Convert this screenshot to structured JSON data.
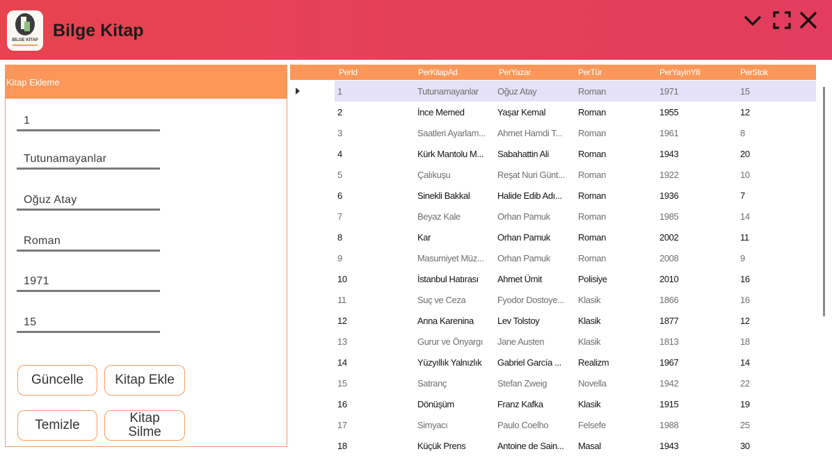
{
  "app": {
    "title": "Bilge Kitap",
    "logo_text": "BİLGE KİTAP"
  },
  "window_controls": [
    "chevron-down-icon",
    "maximize-icon",
    "close-icon"
  ],
  "form": {
    "header": "Kitap Ekleme",
    "fields": {
      "id": "1",
      "kitap_ad": "Tutunamayanlar",
      "yazar": "Oğuz Atay",
      "tur": "Roman",
      "yayin_yili": "1971",
      "stok": "15"
    },
    "buttons": {
      "guncelle": "Güncelle",
      "kitap_ekle": "Kitap Ekle",
      "temizle": "Temizle",
      "kitap_silme": "Kitap Silme"
    }
  },
  "table": {
    "columns": [
      "PerId",
      "PerKitapAd",
      "PerYazar",
      "PerTür",
      "PerYayinYili",
      "PerStok"
    ],
    "rows": [
      [
        "1",
        "Tutunamayanlar",
        "Oğuz Atay",
        "Roman",
        "1971",
        "15"
      ],
      [
        "2",
        "İnce Memed",
        "Yaşar Kemal",
        "Roman",
        "1955",
        "12"
      ],
      [
        "3",
        "Saatleri Ayarlam...",
        "Ahmet Hamdi T...",
        "Roman",
        "1961",
        "8"
      ],
      [
        "4",
        "Kürk Mantolu M...",
        "Sabahattin Ali",
        "Roman",
        "1943",
        "20"
      ],
      [
        "5",
        "Çalıkuşu",
        "Reşat Nuri Günt...",
        "Roman",
        "1922",
        "10"
      ],
      [
        "6",
        "Sinekli Bakkal",
        "Halide Edib Adı...",
        "Roman",
        "1936",
        "7"
      ],
      [
        "7",
        "Beyaz Kale",
        "Orhan Pamuk",
        "Roman",
        "1985",
        "14"
      ],
      [
        "8",
        "Kar",
        "Orhan Pamuk",
        "Roman",
        "2002",
        "11"
      ],
      [
        "9",
        "Masumiyet Müz...",
        "Orhan Pamuk",
        "Roman",
        "2008",
        "9"
      ],
      [
        "10",
        "İstanbul Hatırası",
        "Ahmet Ümit",
        "Polisiye",
        "2010",
        "16"
      ],
      [
        "11",
        "Suç ve Ceza",
        "Fyodor Dostoye...",
        "Klasik",
        "1866",
        "16"
      ],
      [
        "12",
        "Anna Karenina",
        "Lev Tolstoy",
        "Klasik",
        "1877",
        "12"
      ],
      [
        "13",
        "Gurur ve Önyargı",
        "Jane Austen",
        "Klasik",
        "1813",
        "18"
      ],
      [
        "14",
        "Yüzyıllık Yalnızlık",
        "Gabriel García ...",
        "Realizm",
        "1967",
        "14"
      ],
      [
        "15",
        "Satranç",
        "Stefan Zweig",
        "Novella",
        "1942",
        "22"
      ],
      [
        "16",
        "Dönüşüm",
        "Franz Kafka",
        "Klasik",
        "1915",
        "19"
      ],
      [
        "17",
        "Simyacı",
        "Paulo Coelho",
        "Felsefe",
        "1988",
        "25"
      ],
      [
        "18",
        "Küçük Prens",
        "Antoine de Sain...",
        "Masal",
        "1943",
        "30"
      ]
    ]
  }
}
